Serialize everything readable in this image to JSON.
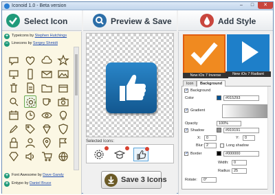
{
  "window": {
    "title": "Iconoid 1.0 - Beta version",
    "min": "–",
    "max": "□",
    "close": "✕"
  },
  "headers": {
    "select": "Select Icon",
    "preview": "Preview & Save",
    "style": "Add Style"
  },
  "packs": [
    {
      "name": "Typeicons",
      "by": "by",
      "author": "Stephen Hutchings",
      "toggle": "+"
    },
    {
      "name": "Linecons",
      "by": "by",
      "author": "Sergey Shmidt",
      "toggle": "–"
    },
    {
      "name": "Font Awesome",
      "by": "by",
      "author": "Dave Gandy",
      "toggle": "+"
    },
    {
      "name": "Entypo",
      "by": "by",
      "author": "Daniel Bruce",
      "toggle": "+"
    }
  ],
  "grid_icons": [
    "bubble-icon",
    "heart-icon",
    "cloud-icon",
    "star-icon",
    "monitor-icon",
    "phone-icon",
    "mail-icon",
    "photo-icon",
    "trash-icon",
    "doc-icon",
    "folder-icon",
    "box-icon",
    "search-icon",
    "gear-icon",
    "cup-icon",
    "camera-icon",
    "calendar-icon",
    "clock-icon",
    "eye-icon",
    "lightbulb-icon",
    "pen-icon",
    "tag-icon",
    "diamond-icon",
    "shield-icon",
    "lock-icon",
    "user-icon",
    "pin-icon",
    "flag-icon",
    "gem-icon",
    "speaker-icon",
    "cart-icon",
    "globe-icon"
  ],
  "preview": {
    "selected_label": "Selected Icons:",
    "save_label": "Save 3 Icons"
  },
  "style": {
    "tiles": [
      {
        "label": "New iOs 7 Inverse"
      },
      {
        "label": "New iOs 7 Radiant"
      }
    ],
    "tabs": [
      "Icon",
      "Background"
    ],
    "background_label": "Background",
    "color_label": "Color",
    "color_value": "#015293",
    "gradient_label": "Gradient",
    "opacity_label": "Opacity",
    "opacity_value": "100%",
    "shadow_label": "Shadow",
    "shadow_value": "#919191",
    "x_label": "X:",
    "x_value": "0",
    "y_label": "Y:",
    "y_value": "0",
    "blur_label": "Blur:",
    "blur_value": "2",
    "long_shadow_label": "Long shadow",
    "border_label": "Border",
    "border_value": "#000000",
    "width_label": "Width:",
    "width_value": "0",
    "radius_label": "Radius:",
    "radius_value": "25",
    "rotate_label": "Rotate:",
    "rotate_value": "0°",
    "check": "✓"
  },
  "colors": {
    "accent": "#1f9a7a",
    "color_swatch": "#015293",
    "shadow_swatch": "#919191",
    "border_swatch": "#000000"
  }
}
